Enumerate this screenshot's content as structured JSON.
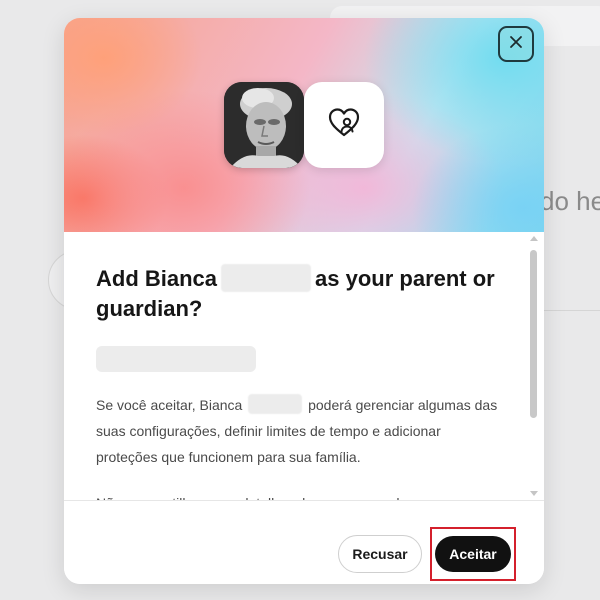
{
  "background": {
    "partial_text": "do he"
  },
  "dialog": {
    "close_label": "×",
    "title_part1": "Add Bianca",
    "title_part2": "as your parent or guardian?",
    "paragraph1_part1": "Se você aceitar, Bianca",
    "paragraph1_part2": "poderá gerenciar algumas das suas configurações, definir limites de tempo e adicionar proteções que funcionem para sua família.",
    "paragraph2": "Não compartilharemos detalhes das conversas do seu",
    "decline_label": "Recusar",
    "accept_label": "Aceitar"
  },
  "colors": {
    "accent_button": "#111111",
    "highlight_border": "#d4202c"
  },
  "icons": {
    "close": "close-icon",
    "guardian": "heart-person-icon"
  }
}
